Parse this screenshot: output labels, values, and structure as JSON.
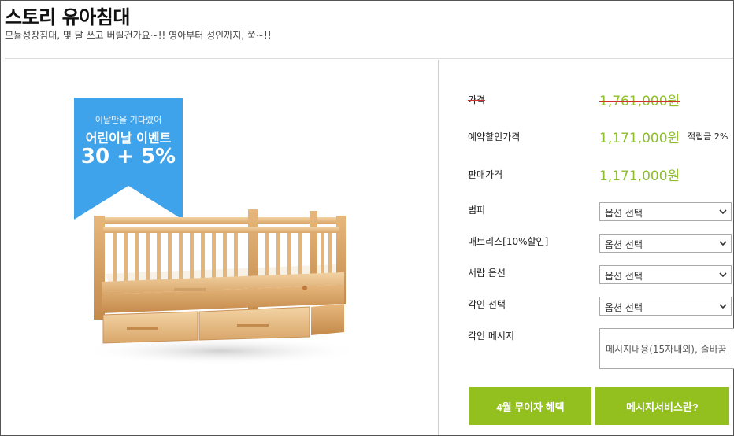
{
  "product": {
    "title": "스토리 유아침대",
    "subtitle": "모듈성장침대, 몇 달 쓰고 버릴건가요~!! 영아부터 성인까지, 쭉~!!"
  },
  "promo": {
    "line1": "이날만을 기다렸어",
    "line2": "어린이날 이벤트",
    "line3": "30 + 5%",
    "color": "#3ea3ea"
  },
  "pricing": {
    "list_price_label": "가격",
    "list_price": "1,761,000원",
    "reserve_label": "예약할인가격",
    "reserve_price": "1,171,000원",
    "points": "적립금 2%",
    "sale_label": "판매가격",
    "sale_price": "1,171,000원",
    "price_color": "#8cbf2a"
  },
  "options": [
    {
      "label": "범퍼",
      "value": "옵션 선택"
    },
    {
      "label": "매트리스[10%할인]",
      "value": "옵션 선택"
    },
    {
      "label": "서랍 옵션",
      "value": "옵션 선택"
    },
    {
      "label": "각인 선택",
      "value": "옵션 선택"
    }
  ],
  "engraving_message": {
    "label": "각인 메시지",
    "placeholder": "메시지내용(15자내외), 줄바꿈"
  },
  "buttons": {
    "april_benefit": "4월 무이자 혜택",
    "message_service": "메시지서비스란?",
    "color": "#93c01f"
  }
}
